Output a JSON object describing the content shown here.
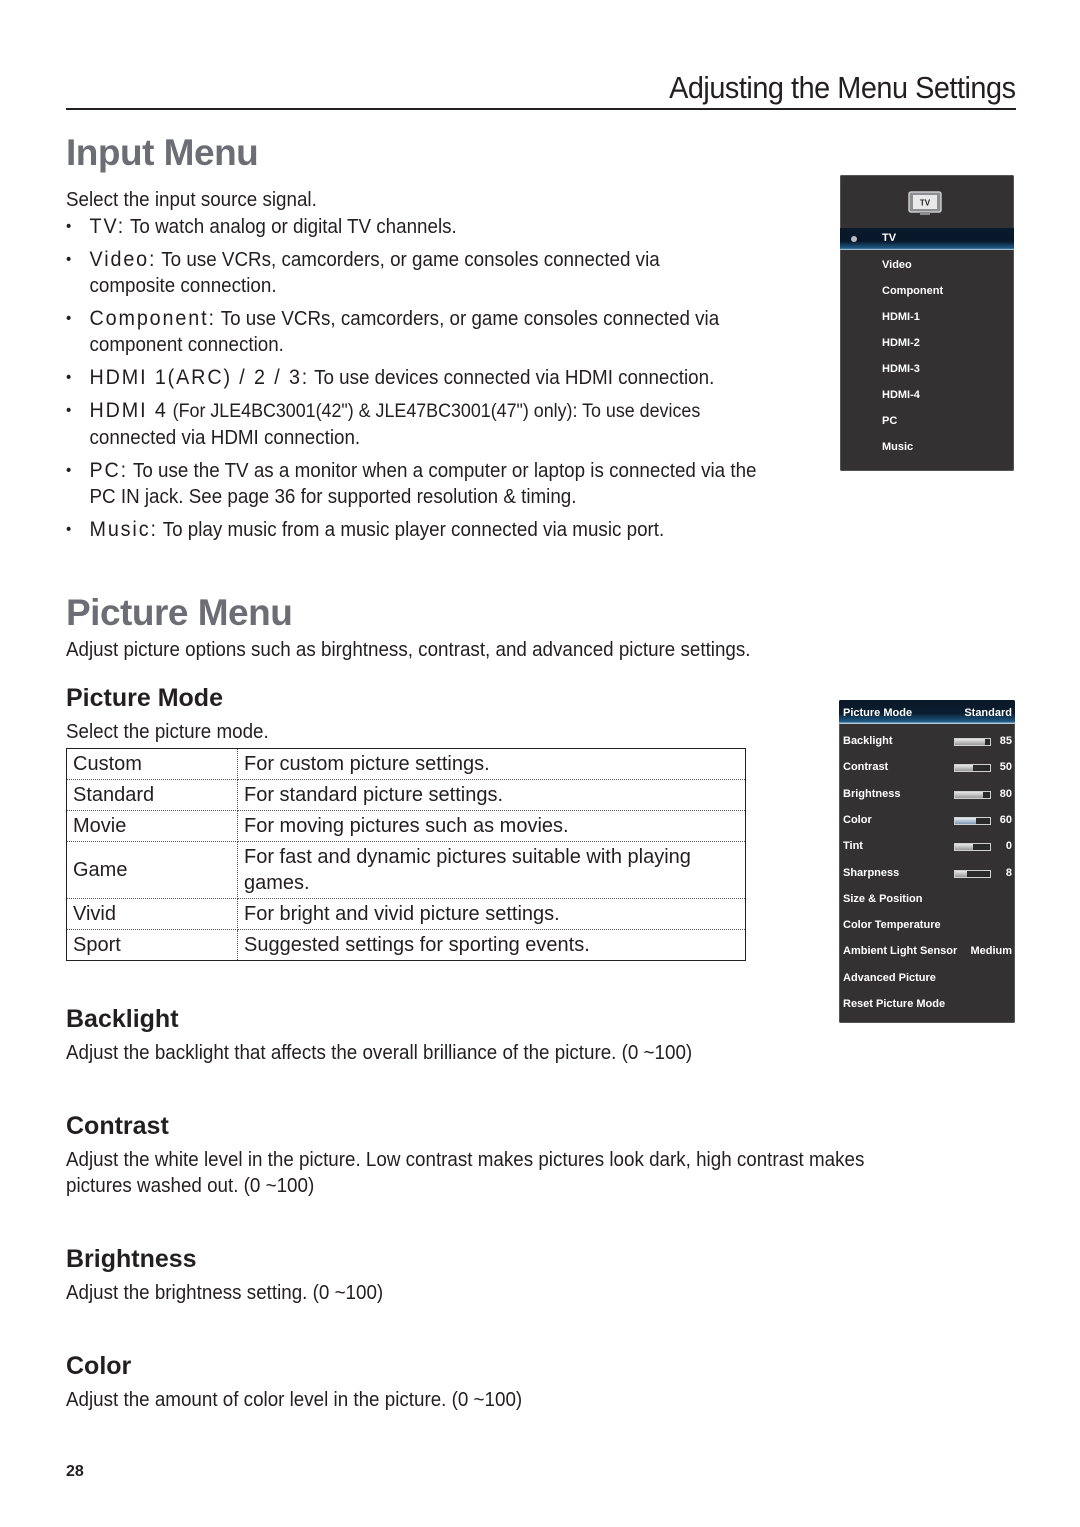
{
  "header": {
    "running_title": "Adjusting the Menu Settings"
  },
  "input_menu": {
    "title": "Input Menu",
    "intro": "Select the input source signal.",
    "bullets": [
      {
        "term": "TV:",
        "text": " To watch analog or digital TV channels.",
        "cont": ""
      },
      {
        "term": "Video:",
        "text": " To use VCRs, camcorders, or game consoles connected via",
        "cont": "composite connection."
      },
      {
        "term": "Component:",
        "text": " To use VCRs, camcorders, or game consoles connected via",
        "cont": "component connection."
      },
      {
        "term": "HDMI 1(ARC) / 2 / 3:",
        "text": " To use devices connected via HDMI connection.",
        "cont": ""
      },
      {
        "term": "HDMI 4",
        "note": " (For JLE4BC3001(42\") & JLE47BC3001(47\") only): To use devices",
        "cont": "connected via HDMI connection."
      },
      {
        "term": "PC:",
        "text": " To use the TV as a monitor when a computer or laptop is connected via the",
        "cont": "PC IN jack. See page 36 for supported resolution & timing."
      },
      {
        "term": "Music:",
        "text": " To play music from a music player connected via music port.",
        "cont": ""
      }
    ],
    "osd": {
      "icon_label": "TV",
      "icon": "tv-icon",
      "items": [
        "TV",
        "Video",
        "Component",
        "HDMI-1",
        "HDMI-2",
        "HDMI-3",
        "HDMI-4",
        "PC",
        "Music"
      ],
      "selected": "TV"
    }
  },
  "picture_menu": {
    "title": "Picture Menu",
    "intro": "Adjust picture options such as birghtness, contrast, and advanced picture settings.",
    "picture_mode": {
      "heading": "Picture Mode",
      "intro": "Select the picture mode.",
      "table": [
        {
          "mode": "Custom",
          "desc": "For custom picture settings."
        },
        {
          "mode": "Standard",
          "desc": "For standard picture settings."
        },
        {
          "mode": "Movie",
          "desc": "For moving pictures such as movies."
        },
        {
          "mode": "Game",
          "desc": "For fast and dynamic pictures suitable with playing games."
        },
        {
          "mode": "Vivid",
          "desc": "For bright and vivid picture settings."
        },
        {
          "mode": "Sport",
          "desc": "Suggested settings for sporting events."
        }
      ]
    },
    "sections": [
      {
        "heading": "Backlight",
        "text": "Adjust the backlight that affects the overall brilliance of the picture. (0 ~100)"
      },
      {
        "heading": "Contrast",
        "text": "Adjust the white level in the picture. Low contrast makes pictures look dark, high contrast makes",
        "cont": "pictures washed out. (0 ~100)"
      },
      {
        "heading": "Brightness",
        "text": "Adjust the brightness setting. (0 ~100)"
      },
      {
        "heading": "Color",
        "text": "Adjust the amount of color level in the picture. (0 ~100)"
      }
    ],
    "osd": {
      "header": {
        "label": "Picture Mode",
        "value": "Standard"
      },
      "sliders": [
        {
          "label": "Backlight",
          "value": "85",
          "fill_fraction": 0.85
        },
        {
          "label": "Contrast",
          "value": "50",
          "fill_fraction": 0.5
        },
        {
          "label": "Brightness",
          "value": "80",
          "fill_fraction": 0.8
        },
        {
          "label": "Color",
          "value": "60",
          "fill_fraction": 0.6
        },
        {
          "label": "Tint",
          "value": "0",
          "fill_fraction": 0.5
        },
        {
          "label": "Sharpness",
          "value": "8",
          "fill_fraction": 0.35
        }
      ],
      "items": [
        {
          "label": "Size & Position",
          "value": ""
        },
        {
          "label": "Color Temperature",
          "value": ""
        },
        {
          "label": "Ambient Light Sensor",
          "value": "Medium"
        },
        {
          "label": "Advanced Picture",
          "value": ""
        },
        {
          "label": "Reset Picture Mode",
          "value": ""
        }
      ]
    }
  },
  "footer": {
    "page_number": "28"
  }
}
